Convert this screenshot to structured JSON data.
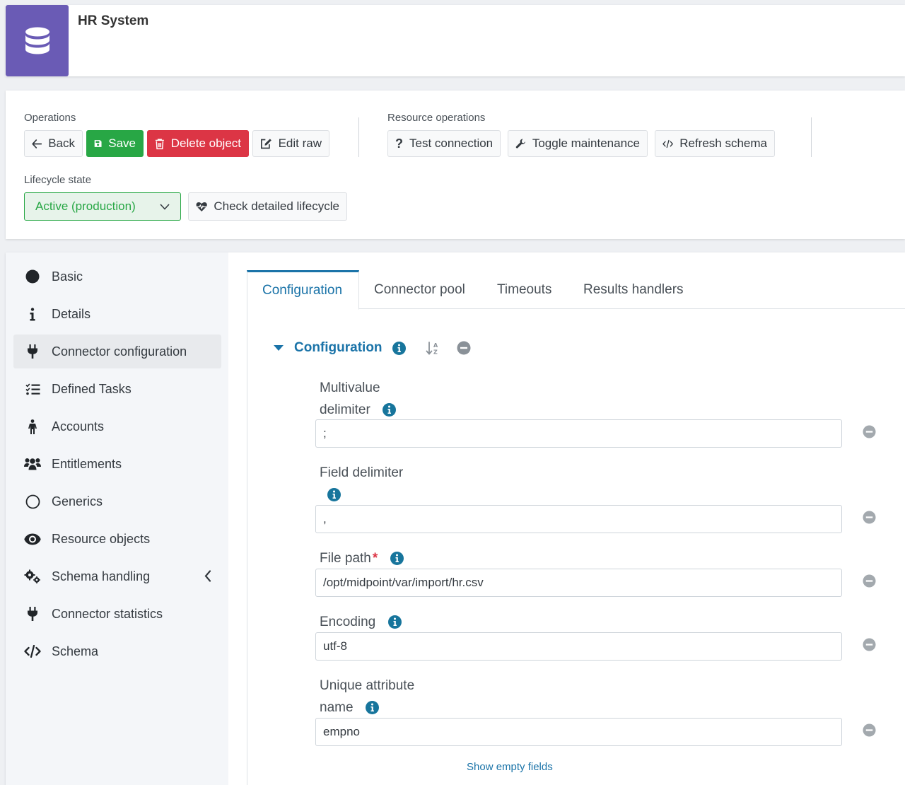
{
  "header": {
    "title": "HR System",
    "icon": "database-icon",
    "accent": "#6a5bb5"
  },
  "operations": {
    "label": "Operations",
    "back": "Back",
    "save": "Save",
    "delete": "Delete object",
    "edit_raw": "Edit raw"
  },
  "resource_operations": {
    "label": "Resource operations",
    "test_connection": "Test connection",
    "toggle_maintenance": "Toggle maintenance",
    "refresh_schema": "Refresh schema"
  },
  "lifecycle": {
    "label": "Lifecycle state",
    "selected": "Active (production)",
    "check_detailed": "Check detailed lifecycle"
  },
  "sidebar": {
    "items": [
      {
        "label": "Basic",
        "icon": "circle-filled-icon"
      },
      {
        "label": "Details",
        "icon": "info-icon"
      },
      {
        "label": "Connector configuration",
        "icon": "plug-icon",
        "active": true
      },
      {
        "label": "Defined Tasks",
        "icon": "task-list-icon"
      },
      {
        "label": "Accounts",
        "icon": "person-icon"
      },
      {
        "label": "Entitlements",
        "icon": "users-icon"
      },
      {
        "label": "Generics",
        "icon": "circle-outline-icon"
      },
      {
        "label": "Resource objects",
        "icon": "eye-icon"
      },
      {
        "label": "Schema handling",
        "icon": "gears-icon"
      },
      {
        "label": "Connector statistics",
        "icon": "plug-icon"
      },
      {
        "label": "Schema",
        "icon": "code-icon"
      }
    ]
  },
  "tabs": [
    {
      "label": "Configuration",
      "active": true
    },
    {
      "label": "Connector pool"
    },
    {
      "label": "Timeouts"
    },
    {
      "label": "Results handlers"
    }
  ],
  "section": {
    "title": "Configuration"
  },
  "fields": {
    "multivalue_delimiter": {
      "label_line1": "Multivalue",
      "label_line2": "delimiter",
      "value": ";"
    },
    "field_delimiter": {
      "label": "Field delimiter",
      "value": ","
    },
    "file_path": {
      "label": "File path",
      "required_mark": "*",
      "value": "/opt/midpoint/var/import/hr.csv"
    },
    "encoding": {
      "label": "Encoding",
      "value": "utf-8"
    },
    "unique_attribute_name": {
      "label_line1": "Unique attribute",
      "label_line2": "name",
      "value": "empno"
    }
  },
  "show_empty_fields": "Show empty fields",
  "colors": {
    "primary": "#1a73a8",
    "success": "#28a745",
    "danger": "#dc3545",
    "info_badge": "#17759c"
  }
}
